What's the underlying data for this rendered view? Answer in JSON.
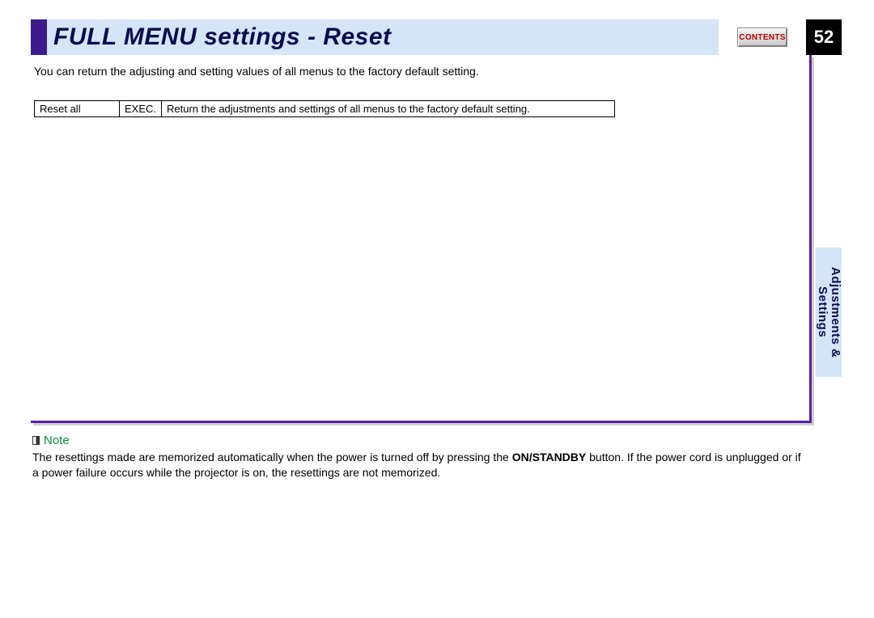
{
  "header": {
    "title": "FULL MENU settings - Reset",
    "contents_label": "CONTENTS",
    "page_number": "52"
  },
  "intro": "You can return the adjusting and setting values of all menus to the factory default setting.",
  "table": {
    "row1": {
      "name": "Reset all",
      "action": "EXEC.",
      "description": "Return the adjustments and settings of all menus to the factory default setting."
    }
  },
  "side_tab": {
    "line1": "Adjustments &",
    "line2": "Settings"
  },
  "note": {
    "heading": "Note",
    "text_before": "The resettings made are memorized automatically when the power is turned off by pressing the ",
    "bold": "ON/STANDBY",
    "text_after": " button. If the power cord is unplugged or if a power failure occurs while the projector is on, the resettings are not memorized."
  }
}
